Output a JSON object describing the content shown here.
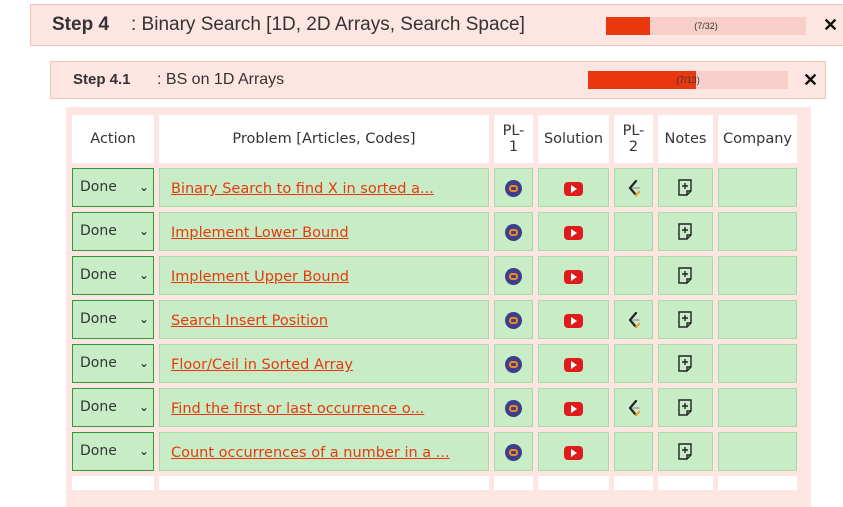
{
  "step": {
    "title": "Step 4",
    "name": ": Binary Search [1D, 2D Arrays, Search Space]",
    "progress_text": "(7/32)",
    "progress_fraction": 0.21875,
    "close": "✕"
  },
  "substep": {
    "title": "Step 4.1",
    "name": ": BS on 1D Arrays",
    "progress_text": "(7/13)",
    "progress_fraction": 0.538,
    "close": "✕"
  },
  "table": {
    "headers": {
      "action": "Action",
      "problem": "Problem [Articles, Codes]",
      "pl1_a": "PL-",
      "pl1_b": "1",
      "solution": "Solution",
      "pl2_a": "PL-",
      "pl2_b": "2",
      "notes": "Notes",
      "company": "Company"
    },
    "rows": [
      {
        "action": "Done",
        "problem": "Binary Search to find X in sorted a...",
        "pl2": true
      },
      {
        "action": "Done",
        "problem": "Implement Lower Bound",
        "pl2": false
      },
      {
        "action": "Done",
        "problem": "Implement Upper Bound",
        "pl2": false
      },
      {
        "action": "Done",
        "problem": "Search Insert Position",
        "pl2": true
      },
      {
        "action": "Done",
        "problem": "Floor/Ceil in Sorted Array",
        "pl2": false
      },
      {
        "action": "Done",
        "problem": "Find the first or last occurrence o...",
        "pl2": true
      },
      {
        "action": "Done",
        "problem": "Count occurrences of a number in a ...",
        "pl2": false
      }
    ]
  },
  "colors": {
    "accent": "#e8380e",
    "row_bg": "#c8edc6",
    "header_bg": "#fde6e2"
  },
  "icons": {
    "pl1": "gfg-icon",
    "solution": "youtube-icon",
    "pl2": "leetcode-icon",
    "notes": "add-note-icon",
    "dropdown": "chevron-down-icon"
  }
}
